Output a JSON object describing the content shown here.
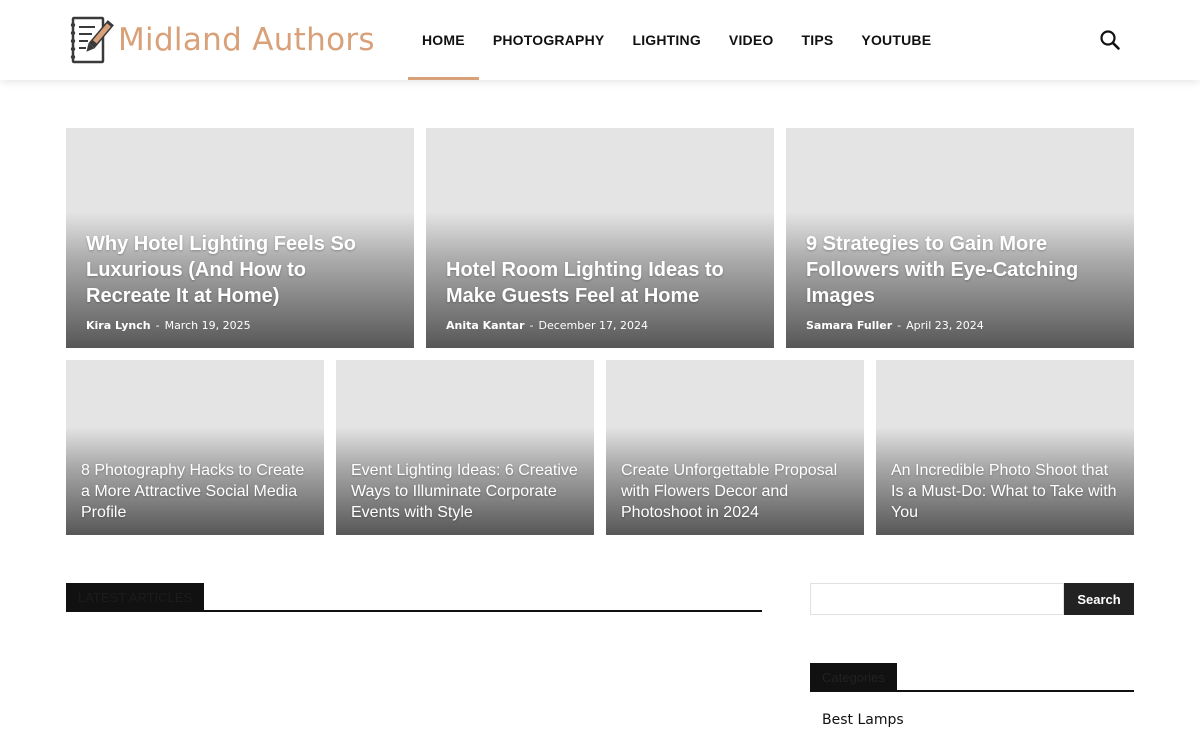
{
  "site": {
    "name": "Midland Authors",
    "brand_color": "#d9a17a"
  },
  "nav": {
    "items": [
      "HOME",
      "PHOTOGRAPHY",
      "LIGHTING",
      "VIDEO",
      "TIPS",
      "YOUTUBE"
    ],
    "active": "HOME",
    "search_icon": "search-icon"
  },
  "featured": [
    {
      "title": "Why Hotel Lighting Feels So Luxurious (And How to Recreate It at Home)",
      "author": "Kira Lynch",
      "sep": "-",
      "date": "March 19, 2025"
    },
    {
      "title": "Hotel Room Lighting Ideas to Make Guests Feel at Home",
      "author": "Anita Kantar",
      "sep": "-",
      "date": "December 17, 2024"
    },
    {
      "title": "9 Strategies to Gain More Followers with Eye-Catching Images",
      "author": "Samara Fuller",
      "sep": "-",
      "date": "April 23, 2024"
    }
  ],
  "secondary": [
    {
      "title": "8 Photography Hacks to Create a More Attractive Social Media Profile"
    },
    {
      "title": "Event Lighting Ideas: 6 Creative Ways to Illuminate Corporate Events with Style"
    },
    {
      "title": "Create Unforgettable Proposal with Flowers Decor and Photoshoot in 2024"
    },
    {
      "title": "An Incredible Photo Shoot that Is a Must-Do: What to Take with You"
    }
  ],
  "latest": {
    "title": "LATEST ARTICLES"
  },
  "sidebar": {
    "search": {
      "placeholder": "",
      "button": "Search"
    },
    "categories": {
      "title": "Categories",
      "items": [
        "Best Lamps"
      ]
    }
  }
}
